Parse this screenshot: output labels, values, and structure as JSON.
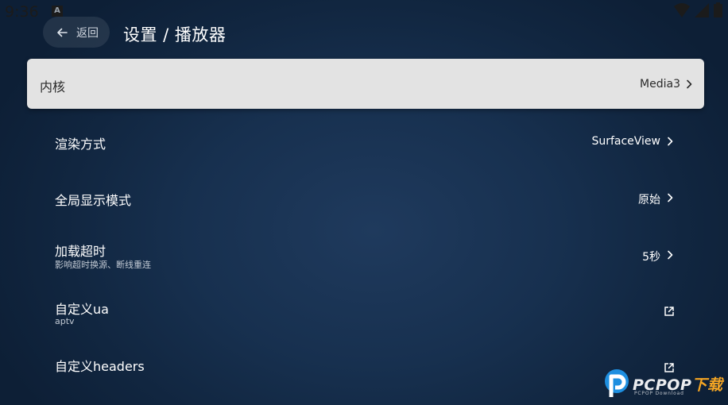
{
  "status_bar": {
    "time": "9:36",
    "badge": "A",
    "icons": [
      "wifi-icon",
      "signal-icon",
      "battery-icon"
    ]
  },
  "header": {
    "back_label": "返回",
    "title": "设置 / 播放器"
  },
  "settings": [
    {
      "title": "内核",
      "value": "Media3",
      "subtitle": "",
      "action": "chevron"
    },
    {
      "title": "渲染方式",
      "value": "SurfaceView",
      "subtitle": "",
      "action": "chevron"
    },
    {
      "title": "全局显示模式",
      "value": "原始",
      "subtitle": "",
      "action": "chevron"
    },
    {
      "title": "加载超时",
      "value": "5秒",
      "subtitle": "影响超时换源、断线重连",
      "action": "chevron"
    },
    {
      "title": "自定义ua",
      "value": "",
      "subtitle": "aptv",
      "action": "external-link"
    },
    {
      "title": "自定义headers",
      "value": "",
      "subtitle": "",
      "action": "external-link"
    }
  ],
  "watermark": {
    "brand_main": "PCPOP",
    "brand_accent": "下载",
    "brand_sub": "PCPOP Download"
  },
  "colors": {
    "background": "#17304f",
    "focused_row": "#e3e3e3",
    "watermark_accent": "#f6a623",
    "watermark_logo": "#1e8fe0"
  }
}
